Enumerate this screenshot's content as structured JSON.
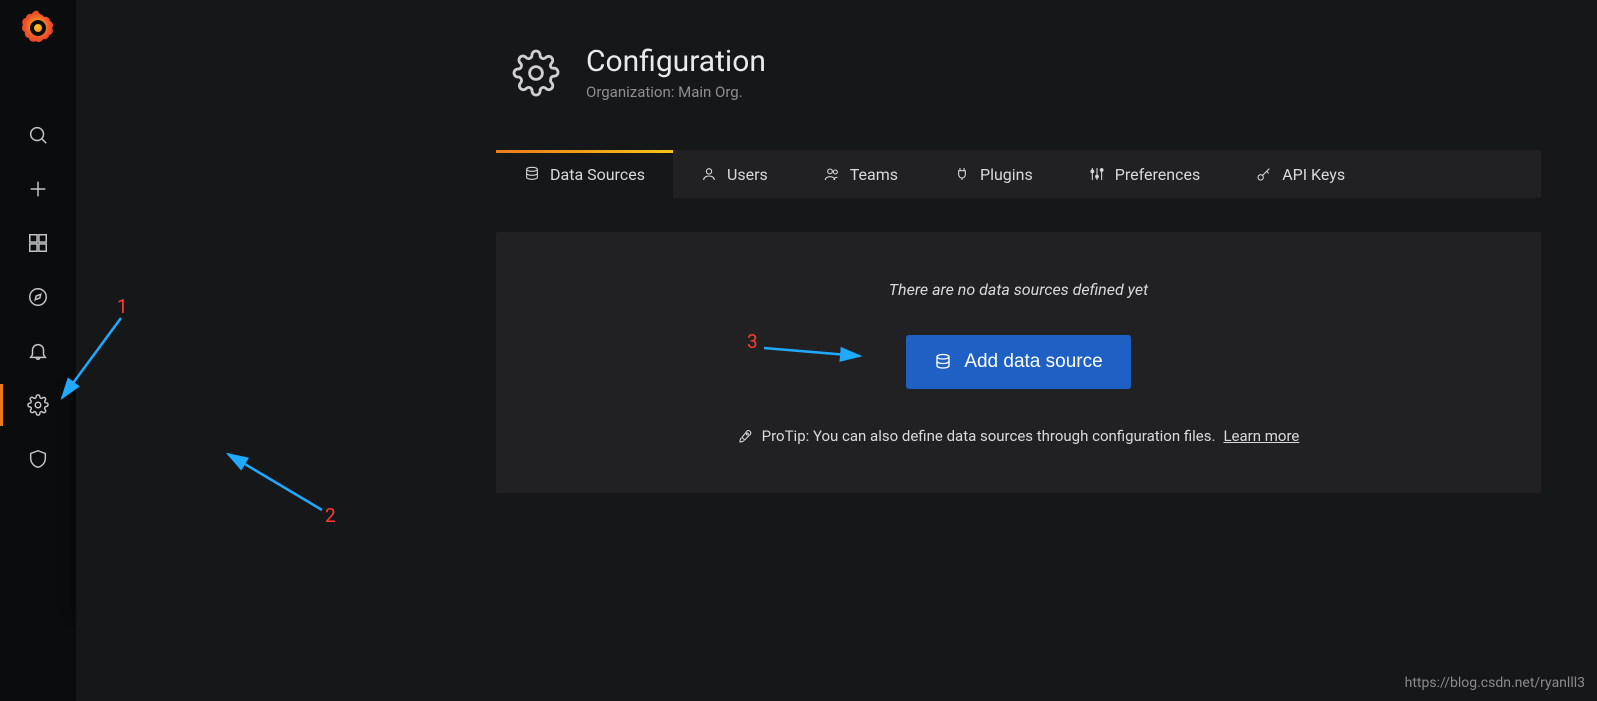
{
  "sidebar": {
    "items": [
      "search",
      "create",
      "dashboards",
      "explore",
      "alerting",
      "configuration",
      "shield"
    ]
  },
  "popup": {
    "title": "Configuration",
    "items": [
      {
        "label": "Data Sources",
        "icon": "database"
      },
      {
        "label": "Users",
        "icon": "user"
      },
      {
        "label": "Teams",
        "icon": "users"
      },
      {
        "label": "Plugins",
        "icon": "plug"
      },
      {
        "label": "Preferences",
        "icon": "sliders"
      },
      {
        "label": "API Keys",
        "icon": "key"
      }
    ]
  },
  "header": {
    "title": "Configuration",
    "subtitle": "Organization: Main Org."
  },
  "tabs": [
    {
      "label": "Data Sources",
      "icon": "database",
      "active": true
    },
    {
      "label": "Users",
      "icon": "user"
    },
    {
      "label": "Teams",
      "icon": "users"
    },
    {
      "label": "Plugins",
      "icon": "plug"
    },
    {
      "label": "Preferences",
      "icon": "sliders"
    },
    {
      "label": "API Keys",
      "icon": "key"
    }
  ],
  "content": {
    "empty_message": "There are no data sources defined yet",
    "add_button": "Add data source",
    "protip_prefix": "ProTip: You can also define data sources through configuration files. ",
    "protip_link": "Learn more"
  },
  "annotations": {
    "one": "1",
    "two": "2",
    "three": "3"
  },
  "watermark": "https://blog.csdn.net/ryanlll3"
}
